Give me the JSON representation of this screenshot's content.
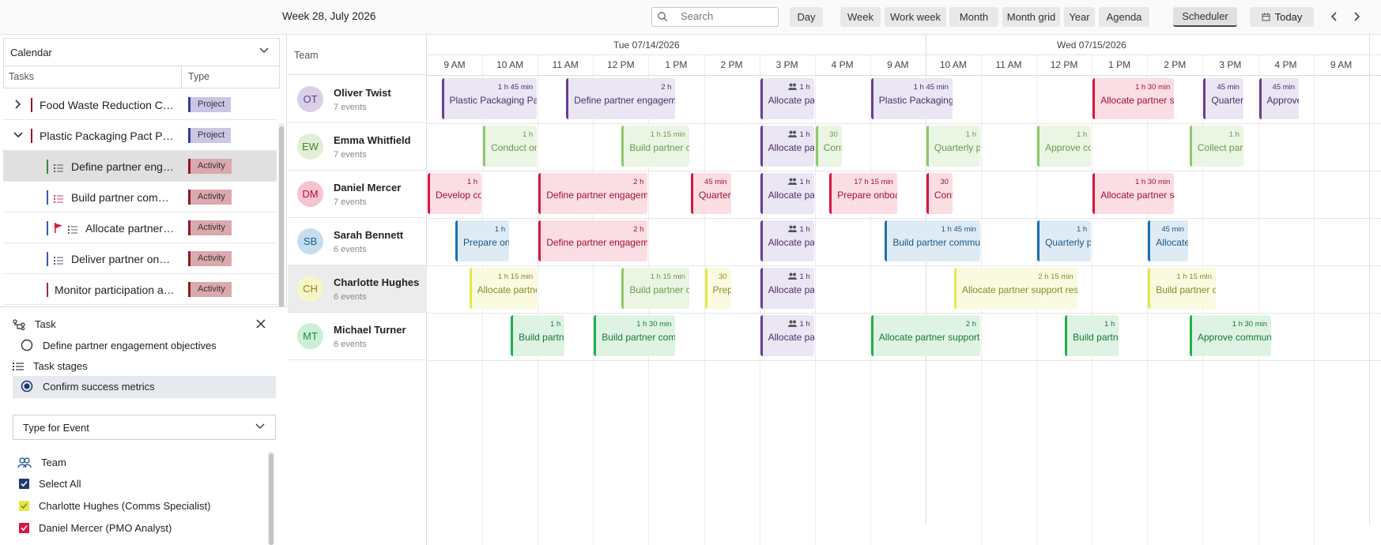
{
  "toolbar": {
    "week_title": "Week 28, July 2026",
    "search_placeholder": "Search",
    "views": [
      "Day",
      "Week",
      "Work week",
      "Month",
      "Month grid",
      "Year",
      "Agenda",
      "Scheduler"
    ],
    "active_view": "Scheduler",
    "today_label": "Today"
  },
  "left": {
    "calendar_label": "Calendar",
    "col_tasks": "Tasks",
    "col_type": "Type",
    "tasks": [
      {
        "label": "Food Waste Reduction Campaign",
        "type": "Project",
        "expand": "right"
      },
      {
        "label": "Plastic Packaging Pact Partners",
        "type": "Project",
        "expand": "down"
      },
      {
        "label": "Define partner engagement objectives",
        "type": "Activity",
        "icon": "list",
        "selected": true
      },
      {
        "label": "Build partner communication plan",
        "type": "Activity",
        "icon": "list-red"
      },
      {
        "label": "Allocate partner support resources",
        "type": "Activity",
        "icon": "flag"
      },
      {
        "label": "Deliver partner onboarding",
        "type": "Activity",
        "icon": "list"
      },
      {
        "label": "Monitor participation and results",
        "type": "Activity",
        "icon": "none"
      }
    ]
  },
  "detail": {
    "task_label": "Task",
    "task_option": "Define partner engagement objectives",
    "stages_label": "Task stages",
    "stage_option": "Confirm success metrics",
    "type_select": "Type for Event",
    "team_label": "Team",
    "select_all": "Select All",
    "members": [
      {
        "label": "Charlotte Hughes (Comms Specialist)",
        "color": "#e3e84a"
      },
      {
        "label": "Daniel Mercer (PMO Analyst)",
        "color": "#d9163f"
      }
    ]
  },
  "scheduler": {
    "team_header": "Team",
    "days": [
      "Tue 07/14/2026",
      "Wed 07/15/2026"
    ],
    "hours": [
      "9 AM",
      "10 AM",
      "11 AM",
      "12 PM",
      "1 PM",
      "2 PM",
      "3 PM",
      "4 PM",
      "9 AM",
      "10 AM",
      "11 AM",
      "12 PM",
      "1 PM",
      "2 PM",
      "3 PM",
      "4 PM",
      "9 AM"
    ],
    "resources": [
      {
        "initials": "OT",
        "name": "Oliver Twist",
        "count": "7 events",
        "bg": "#d9cfe8",
        "fg": "#5b3d8a"
      },
      {
        "initials": "EW",
        "name": "Emma Whitfield",
        "count": "7 events",
        "bg": "#dff0d6",
        "fg": "#4f7f34"
      },
      {
        "initials": "DM",
        "name": "Daniel Mercer",
        "count": "7 events",
        "bg": "#f7c4d0",
        "fg": "#b3123c"
      },
      {
        "initials": "SB",
        "name": "Sarah Bennett",
        "count": "6 events",
        "bg": "#c6ddef",
        "fg": "#1f5f8f"
      },
      {
        "initials": "CH",
        "name": "Charlotte Hughes",
        "count": "6 events",
        "bg": "#f7f6c8",
        "fg": "#8a8a1a",
        "selected": true
      },
      {
        "initials": "MT",
        "name": "Michael Turner",
        "count": "6 events",
        "bg": "#cdeed6",
        "fg": "#1f8a3e"
      }
    ],
    "events": [
      {
        "row": 0,
        "start": 0.25,
        "len": 1.75,
        "dur": "1 h 45 min",
        "title": "Plastic Packaging Pact",
        "theme": "purple"
      },
      {
        "row": 0,
        "start": 2.5,
        "len": 2,
        "dur": "2 h",
        "title": "Define partner engagement",
        "theme": "purple"
      },
      {
        "row": 0,
        "start": 6,
        "len": 1,
        "dur": "1 h",
        "title": "Allocate partner",
        "theme": "purple",
        "group": true
      },
      {
        "row": 0,
        "start": 8,
        "len": 1.5,
        "dur": "1 h 45 min",
        "title": "Plastic Packaging",
        "theme": "purple"
      },
      {
        "row": 0,
        "start": 12,
        "len": 1.5,
        "dur": "1 h 30 min",
        "title": "Allocate partner support",
        "theme": "red"
      },
      {
        "row": 0,
        "start": 14,
        "len": 0.75,
        "dur": "45 min",
        "title": "Quarterly",
        "theme": "purple"
      },
      {
        "row": 0,
        "start": 15,
        "len": 0.75,
        "dur": "45 min",
        "title": "Approve",
        "theme": "purple"
      },
      {
        "row": 1,
        "start": 1,
        "len": 1,
        "dur": "1 h",
        "title": "Conduct onboarding",
        "theme": "green"
      },
      {
        "row": 1,
        "start": 3.5,
        "len": 1.25,
        "dur": "1 h 15 min",
        "title": "Build partner comms",
        "theme": "green"
      },
      {
        "row": 1,
        "start": 6,
        "len": 1,
        "dur": "1 h",
        "title": "Allocate partner",
        "theme": "purple",
        "group": true
      },
      {
        "row": 1,
        "start": 7,
        "len": 0.5,
        "dur": "30",
        "title": "Confirm",
        "theme": "green"
      },
      {
        "row": 1,
        "start": 9,
        "len": 1,
        "dur": "1 h",
        "title": "Quarterly partner",
        "theme": "green"
      },
      {
        "row": 1,
        "start": 11,
        "len": 1,
        "dur": "1 h",
        "title": "Approve comms",
        "theme": "green"
      },
      {
        "row": 1,
        "start": 13.75,
        "len": 1,
        "dur": "1 h",
        "title": "Collect partner",
        "theme": "green"
      },
      {
        "row": 2,
        "start": 0,
        "len": 1,
        "dur": "1 h",
        "title": "Develop comms",
        "theme": "red"
      },
      {
        "row": 2,
        "start": 2,
        "len": 2,
        "dur": "2 h",
        "title": "Define partner engagement",
        "theme": "red"
      },
      {
        "row": 2,
        "start": 4.75,
        "len": 0.75,
        "dur": "45 min",
        "title": "Quarterly",
        "theme": "red"
      },
      {
        "row": 2,
        "start": 6,
        "len": 1,
        "dur": "1 h",
        "title": "Allocate partner",
        "theme": "purple",
        "group": true
      },
      {
        "row": 2,
        "start": 7.25,
        "len": 1.25,
        "dur": "17 h 15 min",
        "title": "Prepare onboarding",
        "theme": "red"
      },
      {
        "row": 2,
        "start": 9,
        "len": 0.5,
        "dur": "30",
        "title": "Confirm",
        "theme": "red"
      },
      {
        "row": 2,
        "start": 12,
        "len": 1.5,
        "dur": "1 h 30 min",
        "title": "Allocate partner support",
        "theme": "red"
      },
      {
        "row": 3,
        "start": 0.5,
        "len": 1,
        "dur": "1 h",
        "title": "Prepare onboarding",
        "theme": "blue"
      },
      {
        "row": 3,
        "start": 2,
        "len": 2,
        "dur": "2 h",
        "title": "Define partner engagement",
        "theme": "red"
      },
      {
        "row": 3,
        "start": 6,
        "len": 1,
        "dur": "1 h",
        "title": "Allocate partner",
        "theme": "purple",
        "group": true
      },
      {
        "row": 3,
        "start": 8.25,
        "len": 1.75,
        "dur": "1 h 45 min",
        "title": "Build partner communication",
        "theme": "blue"
      },
      {
        "row": 3,
        "start": 11,
        "len": 1,
        "dur": "1 h",
        "title": "Quarterly partner",
        "theme": "blue"
      },
      {
        "row": 3,
        "start": 13,
        "len": 0.75,
        "dur": "45 min",
        "title": "Allocate partner",
        "theme": "blue"
      },
      {
        "row": 4,
        "start": 0.75,
        "len": 1.25,
        "dur": "1 h 15 min",
        "title": "Allocate partner",
        "theme": "yellow"
      },
      {
        "row": 4,
        "start": 3.5,
        "len": 1.25,
        "dur": "1 h 15 min",
        "title": "Build partner comms",
        "theme": "green"
      },
      {
        "row": 4,
        "start": 5,
        "len": 0.5,
        "dur": "30",
        "title": "Prepare",
        "theme": "yellow"
      },
      {
        "row": 4,
        "start": 6,
        "len": 1,
        "dur": "1 h",
        "title": "Allocate partner",
        "theme": "purple",
        "group": true
      },
      {
        "row": 4,
        "start": 9.5,
        "len": 2.25,
        "dur": "2 h 15 min",
        "title": "Allocate partner support resources",
        "theme": "yellow"
      },
      {
        "row": 4,
        "start": 13,
        "len": 1.25,
        "dur": "1 h 15 min",
        "title": "Build partner comms",
        "theme": "yellow"
      },
      {
        "row": 5,
        "start": 1.5,
        "len": 1,
        "dur": "1 h",
        "title": "Build partner",
        "theme": "green2"
      },
      {
        "row": 5,
        "start": 3,
        "len": 1.5,
        "dur": "1 h 30 min",
        "title": "Build partner communication",
        "theme": "green2"
      },
      {
        "row": 5,
        "start": 6,
        "len": 1,
        "dur": "1 h",
        "title": "Allocate partner",
        "theme": "purple",
        "group": true
      },
      {
        "row": 5,
        "start": 8,
        "len": 2,
        "dur": "2 h",
        "title": "Allocate partner support",
        "theme": "green2"
      },
      {
        "row": 5,
        "start": 11.5,
        "len": 1,
        "dur": "1 h",
        "title": "Build partner",
        "theme": "green2"
      },
      {
        "row": 5,
        "start": 13.75,
        "len": 1.5,
        "dur": "1 h 30 min",
        "title": "Approve communication",
        "theme": "green2"
      }
    ],
    "themes": {
      "purple": {
        "bg": "#ebe6f3",
        "border": "#6a3d9a",
        "text": "#4a2f6e"
      },
      "red": {
        "bg": "#fbdde4",
        "border": "#d9163f",
        "text": "#a3122f"
      },
      "green": {
        "bg": "#ebf5e4",
        "border": "#8cc86a",
        "text": "#6a9a4a"
      },
      "blue": {
        "bg": "#deebf5",
        "border": "#1f6fae",
        "text": "#1c5685"
      },
      "yellow": {
        "bg": "#fafae0",
        "border": "#e3e84a",
        "text": "#8a8a2a"
      },
      "green2": {
        "bg": "#dff3e5",
        "border": "#1fb04a",
        "text": "#157a33"
      }
    }
  }
}
